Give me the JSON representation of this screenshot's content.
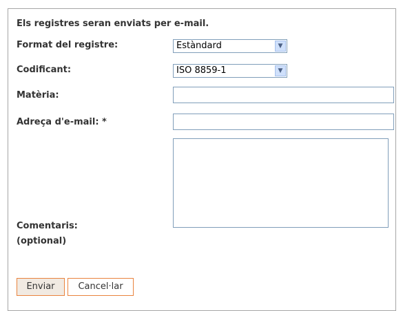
{
  "intro": "Els registres seran enviats per e-mail.",
  "form": {
    "format_label": "Format del registre:",
    "format_value": "Estàndard",
    "encoding_label": "Codificant:",
    "encoding_value": "ISO 8859-1",
    "subject_label": "Matèria:",
    "subject_value": "",
    "email_label": "Adreça d'e-mail: *",
    "email_value": "",
    "comments_label": "Comentaris:",
    "comments_note": "(optional)",
    "comments_value": ""
  },
  "buttons": {
    "send": "Enviar",
    "cancel": "Cancel·lar"
  },
  "icons": {
    "dropdown": "chevron-down-icon"
  }
}
